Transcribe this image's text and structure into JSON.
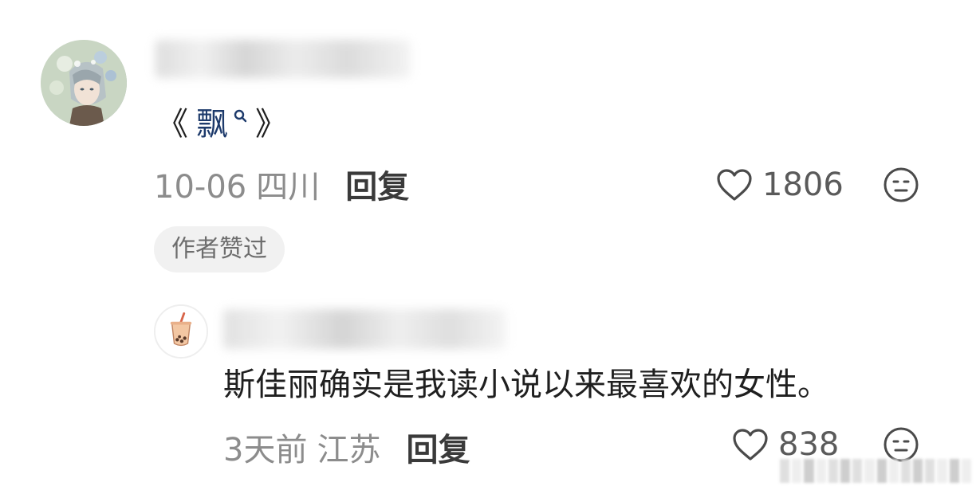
{
  "main_comment": {
    "avatar_icon": "anime-character-avatar",
    "content": {
      "open_quote": "《",
      "link_text": "飘",
      "link_icon": "search-icon",
      "close_quote": "》"
    },
    "date": "10-06",
    "region": "四川",
    "reply_label": "回复",
    "likes": "1806",
    "badge": "作者赞过"
  },
  "reply_comment": {
    "avatar_icon": "bubble-tea-avatar",
    "content": "斯佳丽确实是我读小说以来最喜欢的女性。",
    "date": "3天前",
    "region": "江苏",
    "reply_label": "回复",
    "likes": "838"
  },
  "colors": {
    "link": "#1d3a6b",
    "meta": "#8c8c8c",
    "badge_bg": "#f1f1f1"
  }
}
